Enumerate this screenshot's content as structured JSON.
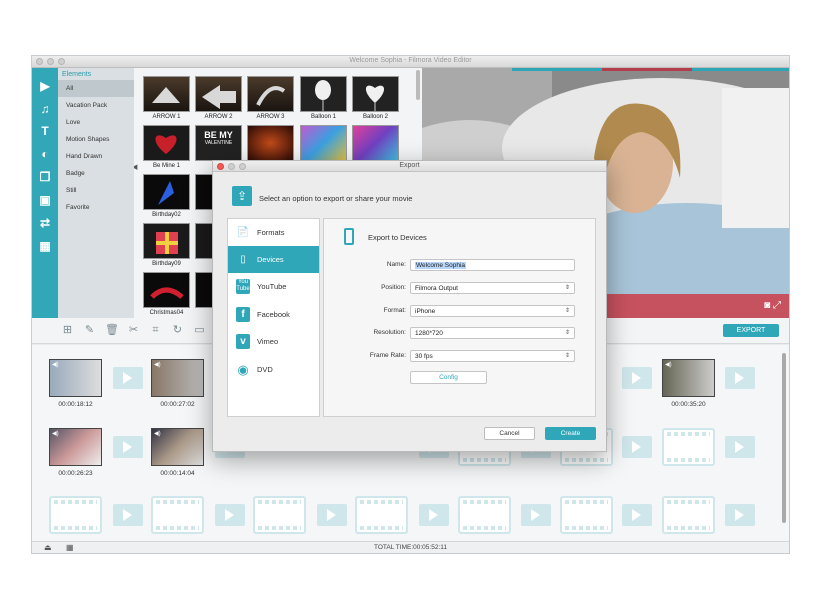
{
  "app": {
    "title": "Welcome Sophia - Filmora Video Editor"
  },
  "categories": {
    "header": "Elements",
    "items": [
      "All",
      "Vacation Pack",
      "Love",
      "Motion Shapes",
      "Hand Drawn",
      "Badge",
      "Still",
      "Favorite"
    ]
  },
  "elements": [
    {
      "label": "ARROW 1"
    },
    {
      "label": "ARROW 2"
    },
    {
      "label": "ARROW 3"
    },
    {
      "label": "Balloon 1"
    },
    {
      "label": "Balloon 2"
    },
    {
      "label": "Be Mine 1"
    },
    {
      "label": "Be"
    },
    {
      "label": "Birthday02"
    },
    {
      "label": "Birt"
    },
    {
      "label": "Birthday09"
    },
    {
      "label": ""
    },
    {
      "label": "Christmas04"
    },
    {
      "label": "Chri"
    }
  ],
  "tile_texts": {
    "be_my": "BE MY",
    "valentine": "VALENTINE"
  },
  "toolbar": {
    "export_label": "EXPORT"
  },
  "timeline": {
    "clips": [
      {
        "time": "00:00:18:12"
      },
      {
        "time": "00:00:27:02"
      },
      {
        "time": "00:00:35:20"
      },
      {
        "time": "00:00:26:23"
      },
      {
        "time": "00:00:14:04"
      }
    ],
    "speaker_glyph": "◀)"
  },
  "status": {
    "total_time": "TOTAL TIME:00:05:52:11"
  },
  "dialog": {
    "title": "Export",
    "heading": "Select an option to export or share your movie",
    "options": [
      {
        "label": "Formats"
      },
      {
        "label": "Devices"
      },
      {
        "label": "YouTube"
      },
      {
        "label": "Facebook"
      },
      {
        "label": "Vimeo"
      },
      {
        "label": "DVD"
      }
    ],
    "panel_title": "Export to Devices",
    "fields": {
      "name_label": "Name:",
      "name_value": "Welcome Sophia",
      "position_label": "Position:",
      "position_value": "Filmora Output",
      "format_label": "Format:",
      "format_value": "iPhone",
      "resolution_label": "Resolution:",
      "resolution_value": "1280*720",
      "framerate_label": "Frame Rate:",
      "framerate_value": "30 fps"
    },
    "config_label": "Config",
    "cancel_label": "Cancel",
    "create_label": "Create"
  },
  "colors": {
    "accent": "#2fa7b8",
    "preview_bar": "#c7525f"
  }
}
